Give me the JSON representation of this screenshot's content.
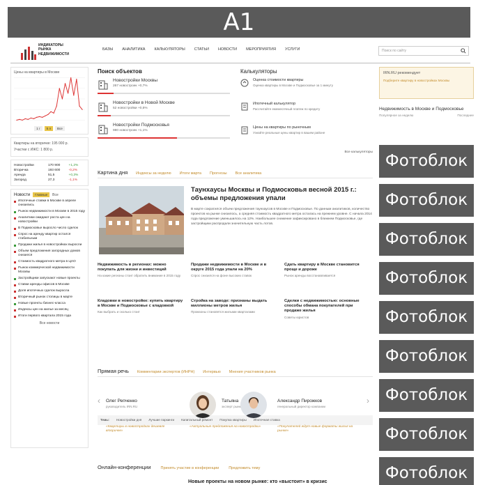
{
  "banner": {
    "label": "A1"
  },
  "header": {
    "logo_lines": [
      "ИНДИКАТОРЫ",
      "РЫНКА",
      "НЕДВИЖИМОСТИ"
    ],
    "nav": [
      "Базы",
      "Аналитика",
      "Калькуляторы",
      "Статьи",
      "Новости",
      "Мероприятия",
      "Услуги"
    ],
    "search_placeholder": "Поиск по сайту"
  },
  "left": {
    "chart_title": "Цены на квартиры в Москве",
    "chart_btn_labels": [
      "1 г",
      "5 л",
      "Все"
    ],
    "price_lines": [
      "Квартиры на вторичке: 195 000 р.",
      "Участки с ИЖС: 1 800 р."
    ],
    "table": [
      [
        "Новостройки",
        "170 900",
        "+1,2%"
      ],
      [
        "Вторичка",
        "193 600",
        "-0,2%"
      ],
      [
        "Аренда",
        "51,5",
        "+0,3%"
      ],
      [
        "Загород",
        "27,3",
        "-1,1%"
      ]
    ],
    "news_title": "Новости",
    "news_tag": "Главные",
    "news_tag2": "Все",
    "news": [
      "Ипотечные ставки в Москве в апреле снизились",
      "Рынок недвижимости в Москве в 2015 году",
      "Аналитики ожидают роста цен на новостройки",
      "В Подмосковье выросло число сделок",
      "Спрос на аренду квартир остался стабильным",
      "Продажи жилья в новостройках выросли",
      "Объем предложения загородных домов снизился",
      "Стоимость квадратного метра в ЦАО",
      "Рынок коммерческой недвижимости Москвы",
      "Застройщики запускают новые проекты",
      "Ставки аренды офисов в Москве",
      "Доля ипотечных сделок выросла",
      "Вторичный рынок столицы в марте",
      "Новые проекты бизнес-класса",
      "Индексы цен на жилье за месяц",
      "Итоги первого квартала 2015 года"
    ],
    "news_all": "Все новости"
  },
  "search_objects": {
    "title": "Поиск объектов",
    "items": [
      {
        "title": "Новостройки Москвы",
        "sub": "267 новостроек  +0,7%",
        "fill": 0.12
      },
      {
        "title": "Новостройки в Новой Москве",
        "sub": "52 новостройки  +0,5%",
        "fill": 0.1
      },
      {
        "title": "Новостройки Подмосковья",
        "sub": "980 новостроек  +1,1%",
        "fill": 0.6
      }
    ]
  },
  "calculators": {
    "title": "Калькуляторы",
    "items": [
      {
        "title": "Оценка стоимости квартиры",
        "sub": "Оценка квартиры в Москве и Подмосковье за 1 минуту"
      },
      {
        "title": "Ипотечный калькулятор",
        "sub": "Рассчитайте ежемесячный платеж по кредиту"
      },
      {
        "title": "Цены на квартиры по рыночным",
        "sub": "Узнайте реальные цены квартир в вашем районе"
      }
    ],
    "all_link": "Все калькуляторы"
  },
  "picture_of_day": {
    "title": "Картина дня",
    "tabs": [
      "Индексы за неделю",
      "Итоги марта",
      "Прогнозы",
      "Все аналитика"
    ],
    "headline": "Таунхаусы Москвы и Подмосковья весной 2015 г.: объемы предложения упали",
    "lead": "В марте сократился объем предложения таунхаусов в Москве и Подмосковье. По данным аналитиков, количество проектов на рынке снизилось, а средняя стоимость квадратного метра осталась на прежнем уровне. С начала 2014 года предложение уменьшилось на 12%. Наибольшее снижение зафиксировано в ближнем Подмосковье, где застройщики распродали значительную часть лотов.",
    "stories": [
      {
        "title": "Недвижимость в регионах: можно покупать для жизни и инвестиций",
        "sub": "На какие регионы стоит обратить внимание в 2015 году"
      },
      {
        "title": "Продажи недвижимости в Москве и в округе 2015 года упали на 20%",
        "sub": "Спрос снизился на фоне высоких ставок"
      },
      {
        "title": "Сдать квартиру в Москве становится проще и дороже",
        "sub": "Рынок аренды восстанавливается"
      },
      {
        "title": "Кладовки в новостройке: купить квартиру в Москве и Подмосковье с кладовкой",
        "sub": "Как выбрать и сколько стоит"
      },
      {
        "title": "Стройка на заводе: признаны выдать миллионы метров жилья",
        "sub": "Промзоны становятся жилыми кварталами"
      },
      {
        "title": "Сделки с недвижимостью: основные способы обмана покупателей при продаже жилья",
        "sub": "Советы юристов"
      }
    ],
    "themes_label": "Темы:",
    "themes": [
      "Новостройки дня",
      "Лучшие паркинги",
      "Капитальный ремонт",
      "Покупка квартиры",
      "Ипотечная ставка"
    ]
  },
  "direct_speech": {
    "title": "Прямая речь",
    "tabs": [
      "Комментарии экспертов (ИНРН)",
      "Интервью",
      "Мнения участников рынка"
    ],
    "people": [
      {
        "name": "Олег Репченко",
        "role": "руководитель IRN.RU",
        "quote": "«Квартиры в новостройках дешевле вторичек»"
      },
      {
        "name": "Татьяна",
        "role": "эксперт рынка недвижимости",
        "quote": "«Актуальные предложения на новостройки»"
      },
      {
        "name": "Александр Пирожков",
        "role": "генеральный директор компании",
        "quote": "«Покупателей ждут новые форматы жилья на рынке»"
      }
    ]
  },
  "online_conf": {
    "title": "Онлайн-конференции",
    "tabs": [
      "Принять участие в конференции",
      "Предложить тему"
    ],
    "headline": "Новые проекты на новом рынке: кто «выстоит» в кризис"
  },
  "right": {
    "promo_title": "IRN.RU рекомендует",
    "promo_sub": "Подберите квартиру в новостройках Москвы",
    "section_title": "Недвижимость в Москве и Подмосковье",
    "links": [
      "Популярное за неделю",
      "Последнее"
    ],
    "photoblock_label": "Фотоблок",
    "photoblock_count": 9
  },
  "chart_data": {
    "type": "line",
    "title": "Цены на квартиры в Москве",
    "values": [
      10,
      11,
      10,
      12,
      11,
      13,
      12,
      14,
      15,
      14,
      16,
      18,
      22,
      20,
      30,
      55,
      40,
      62,
      48,
      70,
      45,
      68,
      30,
      25
    ]
  }
}
